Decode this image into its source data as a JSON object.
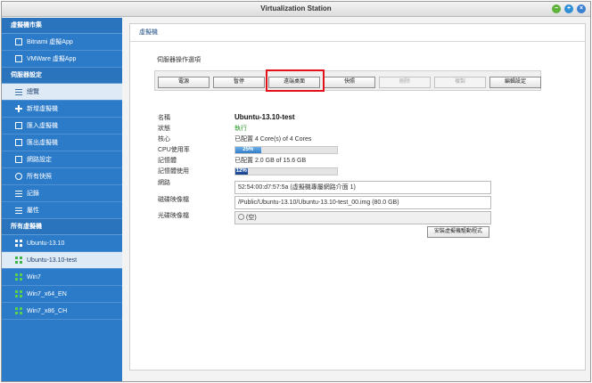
{
  "window": {
    "title": "Virtualization Station"
  },
  "sidebar": {
    "groups": [
      {
        "label": "虛擬機市集"
      },
      {
        "label": "伺服器設定"
      },
      {
        "label": "所有虛擬機"
      }
    ],
    "market_items": [
      {
        "label": "Bitnami 虛擬App"
      },
      {
        "label": "VMWare 虛擬App"
      }
    ],
    "server_items": [
      {
        "label": "總覽"
      },
      {
        "label": "新增虛擬機"
      },
      {
        "label": "匯入虛擬機"
      },
      {
        "label": "匯出虛擬機"
      },
      {
        "label": "網路設定"
      },
      {
        "label": "所有快照"
      },
      {
        "label": "記錄"
      },
      {
        "label": "屬性"
      }
    ],
    "vm_items": [
      {
        "label": "Ubuntu-13.10"
      },
      {
        "label": "Ubuntu-13.10-test"
      },
      {
        "label": "Win7"
      },
      {
        "label": "Win7_x64_EN"
      },
      {
        "label": "Win7_x86_CH"
      }
    ]
  },
  "main": {
    "header": "虛擬機",
    "ops_label": "伺服器操作選項",
    "buttons": [
      {
        "label": "電源"
      },
      {
        "label": "暫停"
      },
      {
        "label": "遠端桌面"
      },
      {
        "label": "快照"
      },
      {
        "label": "刪除"
      },
      {
        "label": "複製"
      },
      {
        "label": "編輯設定"
      }
    ],
    "info": {
      "name_label": "名稱",
      "name_value": "Ubuntu-13.10-test",
      "status_label": "狀態",
      "status_value": "執行",
      "cores_label": "核心",
      "cores_value": "已配置 4 Core(s) of 4 Cores",
      "cpu_label": "CPU使用率",
      "cpu_value": "25%",
      "cpu_percent": 25,
      "mem_label": "記憶體",
      "mem_value": "已配置 2.0 GB of 15.6 GB",
      "memuse_label": "記憶體使用",
      "memuse_value": "12%",
      "memuse_percent": 12,
      "net_label": "網路",
      "net_value": "52:54:00:d7:57:5a (虛擬機專屬網路介面 1)",
      "disk_label": "磁碟映像檔",
      "disk_value": "/Public/Ubuntu-13.10/Ubuntu-13.10-test_00.img (80.0 GB)",
      "cd_label": "光碟映像檔",
      "cd_value": "(空)"
    },
    "install_label": "安裝虛擬機驅動程式"
  },
  "colors": {
    "sidebar_bg": "#2c7bc9",
    "highlight": "#e4111a",
    "running": "#2f9e2f"
  }
}
